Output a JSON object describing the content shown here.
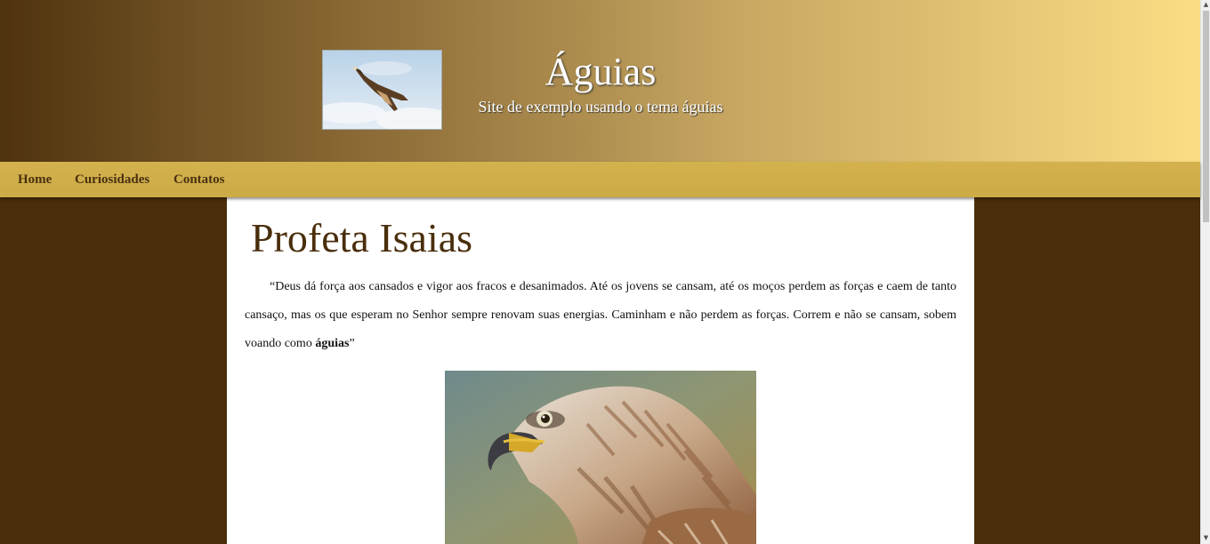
{
  "header": {
    "title": "Águias",
    "subtitle": "Site de exemplo usando o tema águias",
    "logo_alt": "eagle-flying-photo"
  },
  "nav": {
    "items": [
      {
        "label": "Home"
      },
      {
        "label": "Curiosidades"
      },
      {
        "label": "Contatos"
      }
    ]
  },
  "main": {
    "heading": "Profeta Isaias",
    "quote_text": "“Deus dá força aos cansados e vigor aos fracos e desanimados. Até os jovens se cansam, até os moços perdem as forças e caem de tanto cansaço, mas os que esperam no Senhor sempre renovam suas energias. Caminham e não perdem as forças. Correm e não se cansam, sobem voando como ",
    "quote_bold": "águias",
    "quote_end": "”",
    "image": "eagle-head-photo"
  },
  "scrollbar": {
    "up_icon": "scroll-up-arrow-icon",
    "down_icon": "scroll-down-arrow-icon"
  }
}
